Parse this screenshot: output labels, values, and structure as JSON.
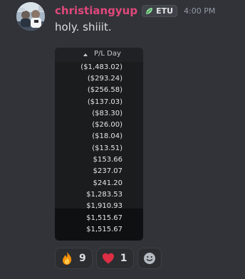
{
  "message": {
    "username": "christiangyup",
    "user_tag": "ETU",
    "timestamp": "4:00 PM",
    "content": "holy. shiiit.",
    "colors": {
      "username": "#e0487a",
      "background": "#313338",
      "tag_leaf": "#8fe39b"
    }
  },
  "attachment": {
    "column_header": "P/L Day",
    "sort_indicator": "sort-ascending-icon",
    "values": [
      "($1,483.02)",
      "($293.24)",
      "($256.58)",
      "($137.03)",
      "($83.30)",
      "($26.00)",
      "($18.04)",
      "($13.51)",
      "$153.66",
      "$237.07",
      "$241.20",
      "$1,283.53",
      "$1,910.93",
      "$1,515.67",
      "$1,515.67"
    ]
  },
  "reactions": [
    {
      "icon": "fire-icon",
      "count": "9"
    },
    {
      "icon": "heart-icon",
      "count": "1"
    }
  ],
  "add_reaction_icon": "add-reaction-smiley-icon"
}
